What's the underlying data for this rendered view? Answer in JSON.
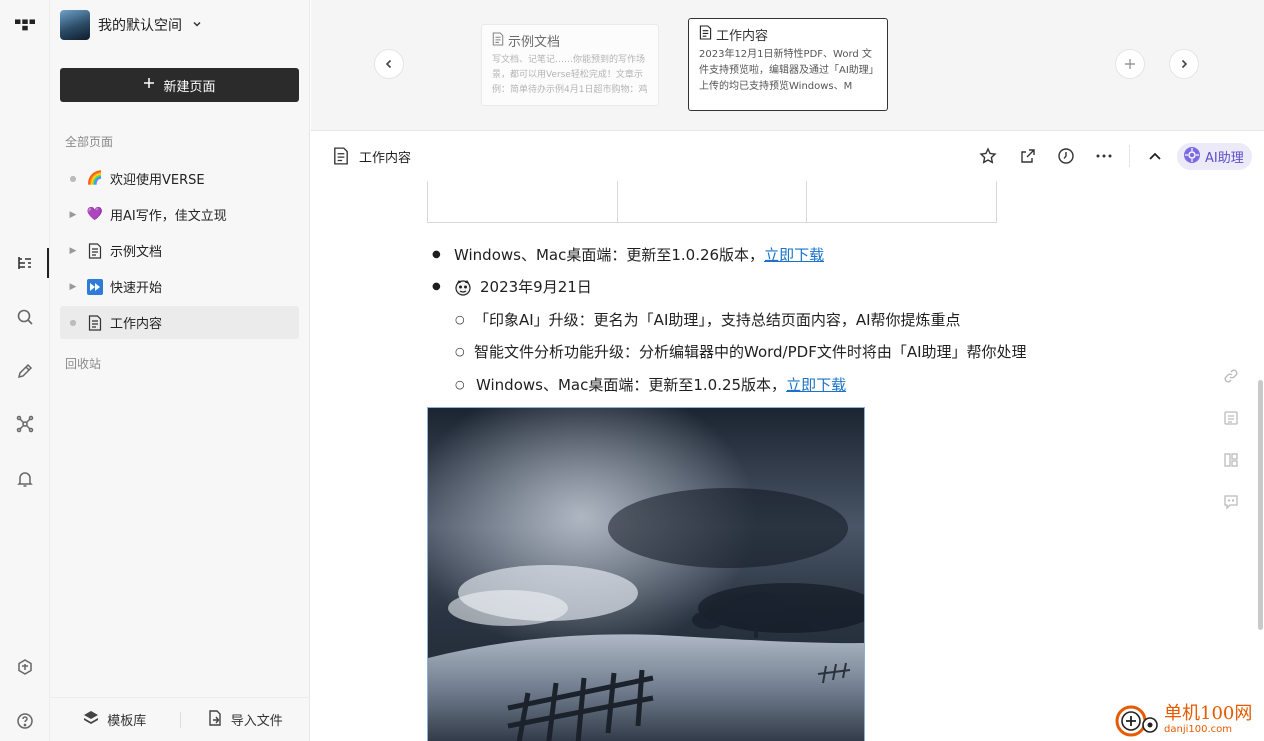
{
  "workspace": {
    "name": "我的默认空间"
  },
  "sidebar": {
    "new_page_label": "新建页面",
    "all_pages_label": "全部页面",
    "items": [
      {
        "emoji": "🌈",
        "label": "欢迎使用VERSE",
        "expandable": false
      },
      {
        "emoji": "💜",
        "label": "用AI写作，佳文立现",
        "expandable": true
      },
      {
        "emoji": "📄",
        "label": "示例文档",
        "expandable": true
      },
      {
        "emoji": "⏩",
        "label": "快速开始",
        "expandable": true
      },
      {
        "emoji": "📄",
        "label": "工作内容",
        "expandable": false,
        "selected": true
      }
    ],
    "trash_label": "回收站",
    "template_label": "模板库",
    "import_label": "导入文件"
  },
  "carousel": {
    "cards": [
      {
        "title": "示例文档",
        "snippet": "写文档、记笔记……你能预到的写作场景，都可以用Verse轻松完成！文章示例：简单待办示例4月1日超市购物：鸡"
      },
      {
        "title": "工作内容",
        "snippet": "2023年12月1日新特性PDF、Word 文件支持预览啦，编辑器及通过「AI助理」上传的均已支持预览Windows、M"
      }
    ]
  },
  "doc": {
    "title": "工作内容",
    "ai_label": "AI助理"
  },
  "content": {
    "line1_text": "Windows、Mac桌面端：更新至1.0.26版本，",
    "line1_link": "立即下载",
    "date_heading": "2023年9月21日",
    "sub1": "「印象AI」升级：更名为「AI助理」，支持总结页面内容，AI帮你提炼重点",
    "sub2": "智能文件分析功能升级：分析编辑器中的Word/PDF文件时将由「AI助理」帮你处理",
    "sub3_text": "Windows、Mac桌面端：更新至1.0.25版本，",
    "sub3_link": "立即下载"
  },
  "watermark": {
    "line1": "单机100网",
    "line2": "danji100.com"
  },
  "colors": {
    "accent": "#5b4fc7",
    "link": "#1a73c9",
    "watermark": "#e65a00"
  }
}
